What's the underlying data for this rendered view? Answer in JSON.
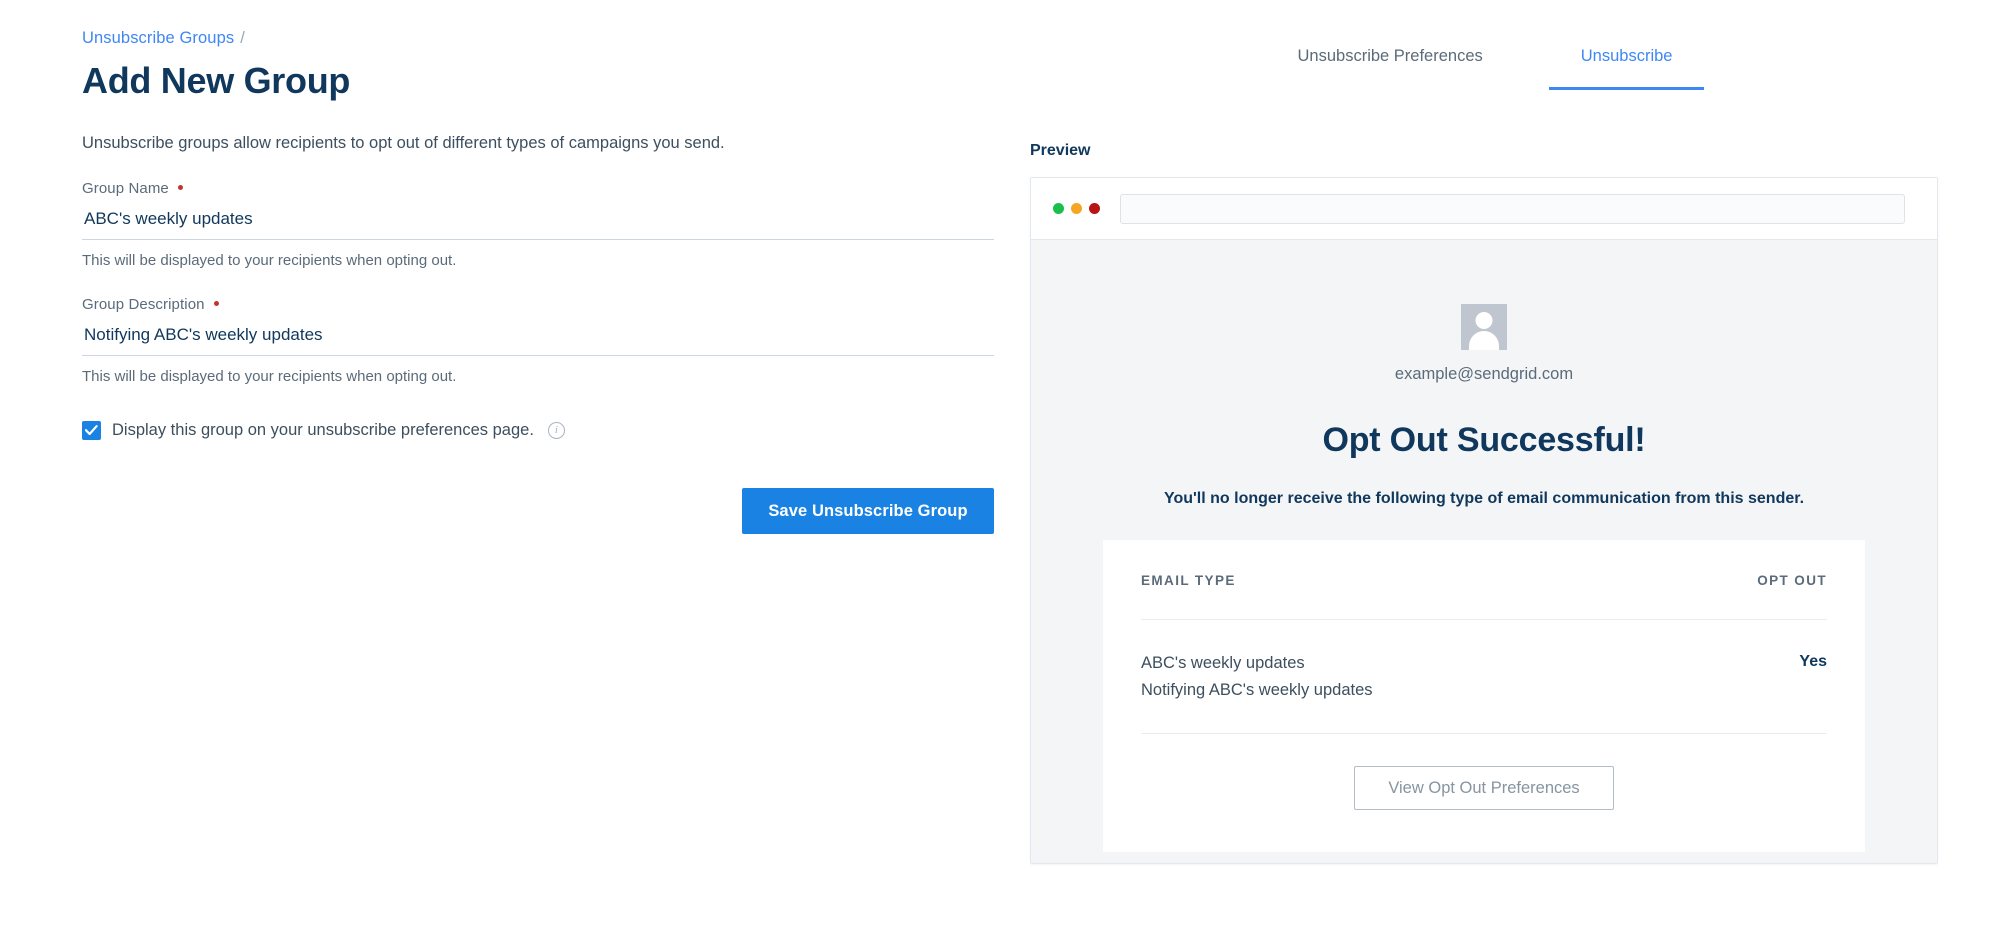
{
  "breadcrumb": {
    "parent": "Unsubscribe Groups",
    "separator": "/"
  },
  "page_title": "Add New Group",
  "intro": "Unsubscribe groups allow recipients to opt out of different types of campaigns you send.",
  "form": {
    "group_name": {
      "label": "Group Name",
      "required_marker": "•",
      "value": "ABC's weekly updates",
      "placeholder": "Group Name",
      "help": "This will be displayed to your recipients when opting out."
    },
    "group_description": {
      "label": "Group Description",
      "required_marker": "•",
      "value": "Notifying ABC's weekly updates",
      "placeholder": "Group Description",
      "help": "This will be displayed to your recipients when opting out."
    },
    "display_checkbox": {
      "label": "Display this group on your unsubscribe preferences page.",
      "checked": true,
      "info_glyph": "i"
    },
    "save_button": "Save Unsubscribe Group"
  },
  "tabs": [
    {
      "label": "Unsubscribe Preferences",
      "active": false
    },
    {
      "label": "Unsubscribe",
      "active": true
    }
  ],
  "preview": {
    "label": "Preview",
    "browser": {
      "dots": [
        "green",
        "orange",
        "red"
      ],
      "url_value": ""
    },
    "email": "example@sendgrid.com",
    "success_title": "Opt Out Successful!",
    "success_subtitle": "You'll no longer receive the following type of email communication from this sender.",
    "table": {
      "headers": [
        "EMAIL TYPE",
        "OPT OUT"
      ],
      "rows": [
        {
          "name": "ABC's weekly updates",
          "description": "Notifying ABC's weekly updates",
          "opt_out": "Yes"
        }
      ]
    },
    "view_prefs_button": "View Opt Out Preferences"
  },
  "colors": {
    "accent_blue": "#1a82e2",
    "link_blue": "#3f87f5",
    "navy": "#10375c",
    "body_gray": "#3d4f5e",
    "muted_gray": "#5b6b7a",
    "required_red": "#c0362c",
    "dot_green": "#19bf4a",
    "dot_orange": "#f5a623",
    "dot_red": "#b81414"
  }
}
